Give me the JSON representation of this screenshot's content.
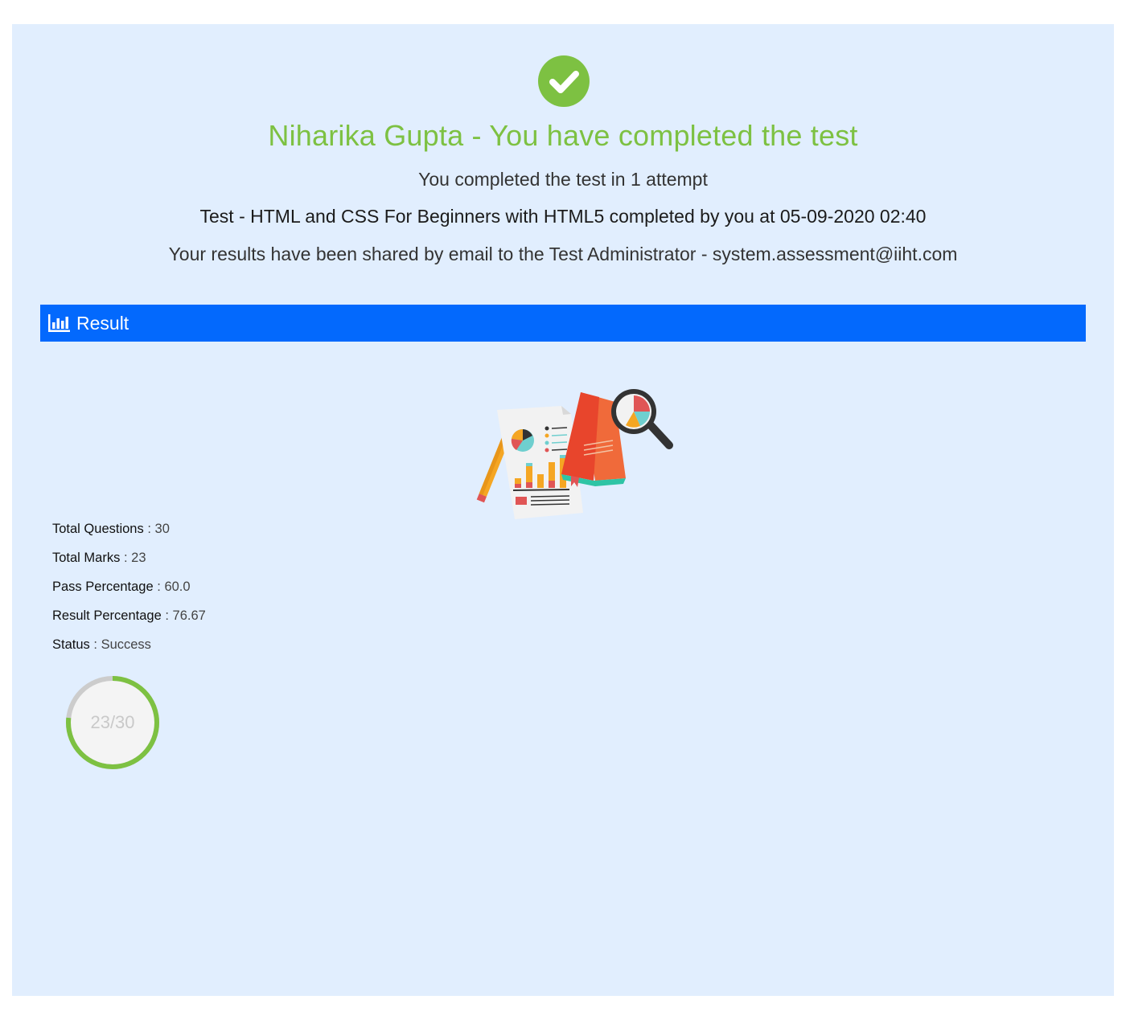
{
  "header": {
    "title": "Niharika Gupta - You have completed the test",
    "attempt_text": "You completed the test in 1 attempt",
    "test_text": "Test - HTML and CSS For Beginners with HTML5 completed by you at 05-09-2020 02:40",
    "email_text": "Your results have been shared by email to the Test Administrator - system.assessment@iiht.com",
    "success_color": "#7dc142"
  },
  "result_bar": {
    "label": "Result",
    "icon": "bar-chart-icon",
    "color": "#0369fd"
  },
  "stats": [
    {
      "key": "Total Questions",
      "value": "30"
    },
    {
      "key": "Total Marks",
      "value": "23"
    },
    {
      "key": "Pass Percentage",
      "value": "60.0"
    },
    {
      "key": "Result Percentage",
      "value": "76.67"
    },
    {
      "key": "Status",
      "value": "Success"
    }
  ],
  "stat_separator": ":",
  "progress": {
    "text": "23/30",
    "fraction": 0.7667,
    "fill_color": "#7dc142",
    "track_color": "#cccccc"
  }
}
